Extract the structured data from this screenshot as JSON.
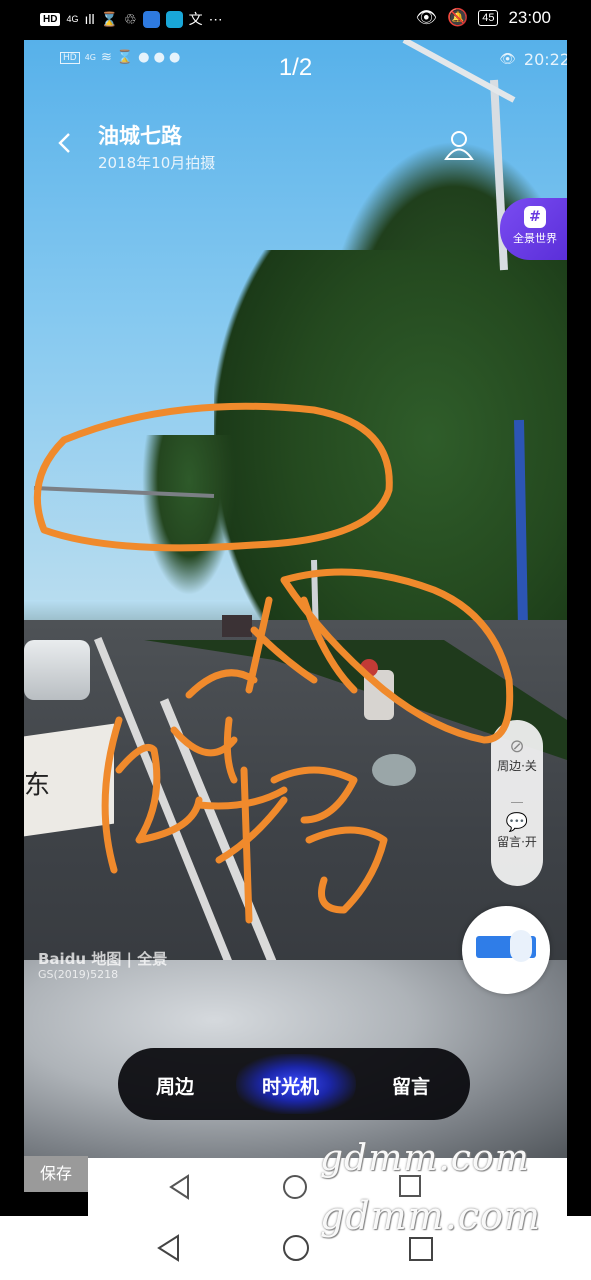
{
  "phone_status": {
    "left_badge": "HD",
    "network": "4G",
    "signal": "ıll",
    "more": "⋯",
    "battery": "45",
    "time": "23:00"
  },
  "inner_status": {
    "badge": "HD",
    "network": "4G",
    "time": "20:22"
  },
  "viewer": {
    "counter": "1/2"
  },
  "header": {
    "title": "油城七路",
    "subtitle": "2018年10月拍摄"
  },
  "world_button": {
    "label": "全景世界"
  },
  "side_panel": {
    "nearby_label": "周边·关",
    "comment_label": "留言·开"
  },
  "panorama_watermark": {
    "brand": "Baidu 地图 | 全景",
    "code": "GS(2019)5218"
  },
  "road_sign_text": "东",
  "annotation_text": "[handwritten scribble in orange]",
  "bottom_tabs": {
    "items": [
      {
        "label": "周边"
      },
      {
        "label": "时光机"
      },
      {
        "label": "留言"
      }
    ],
    "active_index": 1
  },
  "save_button": {
    "label": "保存"
  },
  "site_watermark": {
    "text": "gdmm.com"
  },
  "colors": {
    "annotation": "#f08a2c",
    "world_button": "#6a3be0",
    "toggle_blue": "#2f7de8"
  }
}
